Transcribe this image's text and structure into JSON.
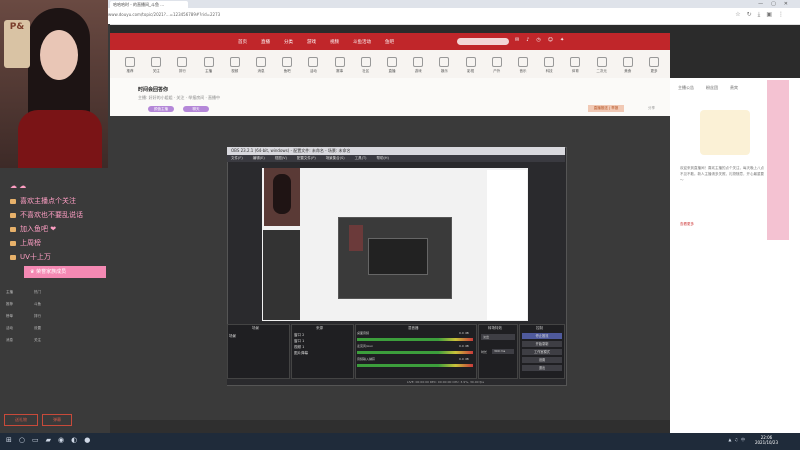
{
  "browser": {
    "tab_title": "哈哈哈时 - 的直播间_斗鱼 ...",
    "url": "www.douyu.com/topic/2021?...=123456789#?rid=2273",
    "window_controls": [
      "—",
      "▢",
      "✕"
    ],
    "toolbar_icons": [
      "star-icon",
      "history-icon",
      "download-icon",
      "extension-icon",
      "menu-icon"
    ]
  },
  "site": {
    "nav": [
      "首页",
      "直播",
      "分类",
      "游戏",
      "视频",
      "斗鱼活动",
      "鱼吧"
    ],
    "categories": [
      "推荐",
      "关注",
      "排行",
      "主播",
      "视频",
      "消息",
      "鱼吧",
      "活动",
      "赛事",
      "社区",
      "直播",
      "游戏",
      "娱乐",
      "影视",
      "户外",
      "音乐",
      "科技",
      "体育",
      "二次元",
      "美食",
      "更多"
    ]
  },
  "room": {
    "title": "时间会回答你",
    "subtitle": "主播: 好好的小姐姐 · 关注 · 举报房间 · 直播中",
    "tags": [
      "颜值主播",
      "聊天"
    ],
    "report_button": "直播推送 | 举报",
    "share": "分享"
  },
  "sidebar": {
    "menu": [
      {
        "label": "喜欢主播点个关注"
      },
      {
        "label": "不喜欢也不要乱说话"
      },
      {
        "label": "加入鱼吧 ❤"
      },
      {
        "label": "上周榜"
      },
      {
        "label": "UV十上万"
      }
    ],
    "menu_highlight": "♛ 荣誉家族成员",
    "sign_text": "P&",
    "list_rows": [
      "主播",
      "热门",
      "推荐",
      "斗鱼",
      "榜单",
      "排行",
      "活动",
      "设置",
      "消息",
      "关注"
    ],
    "buttons": [
      "送礼物",
      "弹幕"
    ]
  },
  "right_panel": {
    "tabs": [
      "主播公告",
      "粉丝团",
      "贵宾"
    ],
    "notice": "欢迎来到直播间！喜欢主播的点个关注，每天晚上八点不见不散。新人主播请多关照，礼物随意，开心最重要～",
    "link": "查看更多"
  },
  "obs": {
    "title": "OBS 23.2.1 (64-bit, windows) - 配置文件: 未命名 - 场景: 未命名",
    "menu": [
      "文件(F)",
      "编辑(E)",
      "视图(V)",
      "配置文件(P)",
      "场景集合(S)",
      "工具(T)",
      "帮助(H)"
    ],
    "docks": [
      "场景",
      "来源",
      "混音器",
      "转场特效",
      "控制"
    ],
    "scenes": [
      "场景"
    ],
    "sources": [
      "窗口 2",
      "窗口 1",
      "视频 1",
      "图片弹幕"
    ],
    "mixer": [
      "桌面音频",
      "麦克风/Aux",
      "音频输入捕获"
    ],
    "mixer_db": [
      "0.0 dB",
      "0.0 dB",
      "0.0 dB"
    ],
    "transition": "淡出",
    "duration_label": "时长",
    "duration_value": "300 ms",
    "controls": [
      "停止推流",
      "开始录制",
      "工作室模式",
      "设置",
      "退出"
    ],
    "status": "LIVE: 00:00:00   REC: 00:00:00   CPU: 3.9%, 30.00 fps"
  },
  "taskbar": {
    "time": "22:06",
    "date": "2021/10/23",
    "icons": [
      "windows-icon",
      "search-icon",
      "taskview-icon",
      "folder-icon",
      "chrome-icon",
      "edge-icon",
      "obs-icon"
    ]
  }
}
